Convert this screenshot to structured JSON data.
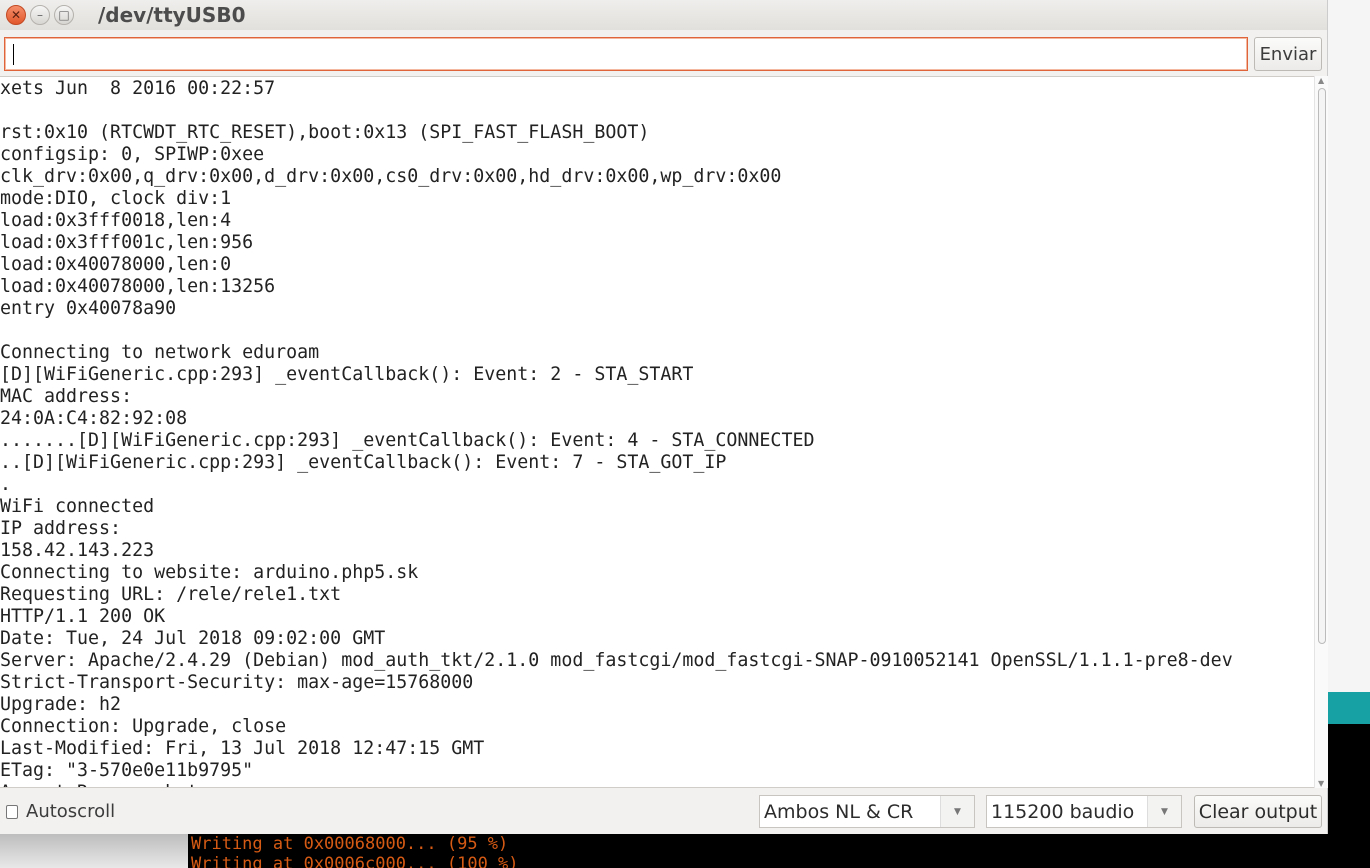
{
  "window": {
    "title": "/dev/ttyUSB0"
  },
  "input": {
    "value": "",
    "send_label": "Enviar"
  },
  "output_lines": [
    "xets Jun  8 2016 00:22:57",
    "",
    "rst:0x10 (RTCWDT_RTC_RESET),boot:0x13 (SPI_FAST_FLASH_BOOT)",
    "configsip: 0, SPIWP:0xee",
    "clk_drv:0x00,q_drv:0x00,d_drv:0x00,cs0_drv:0x00,hd_drv:0x00,wp_drv:0x00",
    "mode:DIO, clock div:1",
    "load:0x3fff0018,len:4",
    "load:0x3fff001c,len:956",
    "load:0x40078000,len:0",
    "load:0x40078000,len:13256",
    "entry 0x40078a90",
    "",
    "Connecting to network eduroam",
    "[D][WiFiGeneric.cpp:293] _eventCallback(): Event: 2 - STA_START",
    "MAC address:",
    "24:0A:C4:82:92:08",
    ".......[D][WiFiGeneric.cpp:293] _eventCallback(): Event: 4 - STA_CONNECTED",
    "..[D][WiFiGeneric.cpp:293] _eventCallback(): Event: 7 - STA_GOT_IP",
    ".",
    "WiFi connected",
    "IP address:",
    "158.42.143.223",
    "Connecting to website: arduino.php5.sk",
    "Requesting URL: /rele/rele1.txt",
    "HTTP/1.1 200 OK",
    "Date: Tue, 24 Jul 2018 09:02:00 GMT",
    "Server: Apache/2.4.29 (Debian) mod_auth_tkt/2.1.0 mod_fastcgi/mod_fastcgi-SNAP-0910052141 OpenSSL/1.1.1-pre8-dev",
    "Strict-Transport-Security: max-age=15768000",
    "Upgrade: h2",
    "Connection: Upgrade, close",
    "Last-Modified: Fri, 13 Jul 2018 12:47:15 GMT",
    "ETag: \"3-570e0e11b9795\"",
    "Accept-Ranges: bytes"
  ],
  "bottom": {
    "autoscroll_label": "Autoscroll",
    "autoscroll_checked": false,
    "line_ending": "Ambos NL & CR",
    "baud_rate": "115200 baudio",
    "clear_label": "Clear output"
  },
  "background_console": [
    "Writing at 0x00068000... (95 %)",
    "Writing at 0x0006c000... (100 %)"
  ],
  "colors": {
    "accent": "#e0643a",
    "console_text": "#d55a14",
    "teal": "#17a1a5"
  }
}
